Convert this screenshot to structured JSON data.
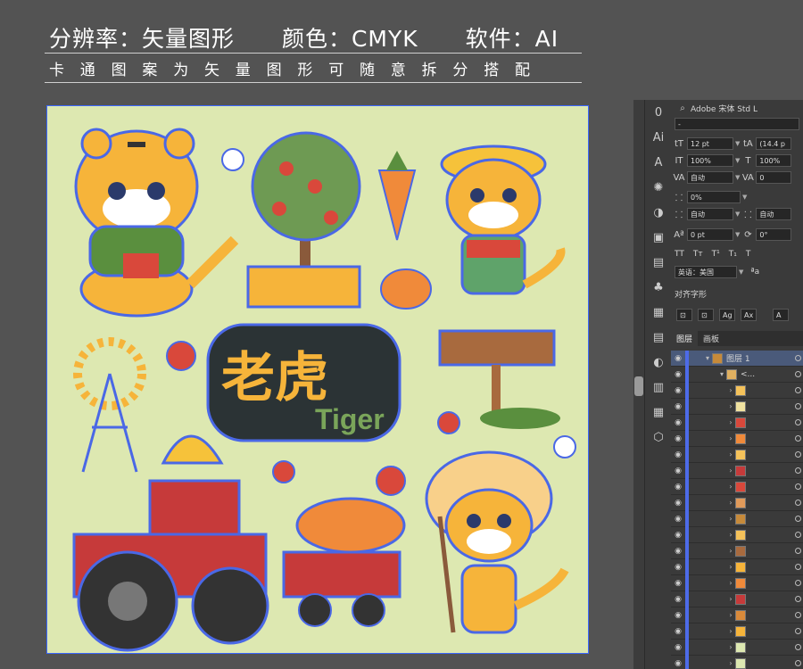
{
  "banner": {
    "spec_type": "分辨率：矢量图形",
    "spec_color": "颜色：CMYK",
    "spec_software": "软件：AI",
    "subtitle": "卡通图案为矢量图形可随意拆分搭配"
  },
  "artwork": {
    "title_cn": "老虎",
    "title_en": "Tiger",
    "background_color": "#dde8b1"
  },
  "character_panel": {
    "font_search": "Adobe 宋体 Std L",
    "font_style": "-",
    "font_size": "12 pt",
    "leading": "(14.4 p",
    "vertical_scale": "100%",
    "horizontal_scale": "100%",
    "kerning": "自动",
    "tracking": "0",
    "tsume": "0%",
    "aki_left": "自动",
    "aki_right": "自动",
    "baseline_shift": "0 pt",
    "rotation": "0°",
    "type_buttons": [
      "TT",
      "Tт",
      "T¹",
      "T₁",
      "T"
    ],
    "language": "英语：美国",
    "anti_alias": "ªa",
    "glyph_section": "对齐字形"
  },
  "layers_panel": {
    "tabs": [
      "图层",
      "画板"
    ],
    "layer_name": "图层 1",
    "sublayer_name": "<...",
    "rows": 18
  },
  "tools": [
    "0",
    "Ai",
    "A",
    "✺",
    "◑",
    "▣",
    "▤",
    "♣",
    "▦",
    "▤",
    "◐",
    "▥",
    "▦",
    "⬡"
  ]
}
